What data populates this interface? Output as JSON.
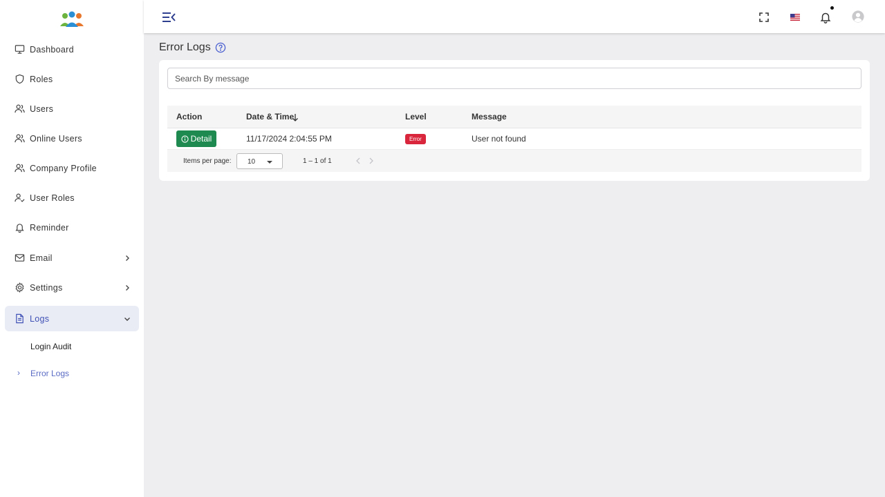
{
  "sidebar": {
    "items": [
      {
        "label": "Dashboard",
        "icon": "monitor-icon"
      },
      {
        "label": "Roles",
        "icon": "shield-icon"
      },
      {
        "label": "Users",
        "icon": "users-icon"
      },
      {
        "label": "Online Users",
        "icon": "users-icon"
      },
      {
        "label": "Company Profile",
        "icon": "users-icon"
      },
      {
        "label": "User Roles",
        "icon": "user-check-icon"
      },
      {
        "label": "Reminder",
        "icon": "bell-icon"
      },
      {
        "label": "Email",
        "icon": "mail-icon",
        "expandable": true
      },
      {
        "label": "Settings",
        "icon": "gear-icon",
        "expandable": true
      },
      {
        "label": "Logs",
        "icon": "file-icon",
        "expanded": true,
        "active": true
      }
    ],
    "sub_items": [
      {
        "label": "Login Audit"
      },
      {
        "label": "Error Logs",
        "active": true
      }
    ]
  },
  "page": {
    "title": "Error Logs"
  },
  "search": {
    "placeholder": "Search By message"
  },
  "table": {
    "columns": [
      "Action",
      "Date & Time",
      "Level",
      "Message"
    ],
    "sort_column": "Date & Time",
    "sort_direction": "desc",
    "rows": [
      {
        "action": "Detail",
        "datetime": "11/17/2024 2:04:55 PM",
        "level": "Error",
        "message": "User not found"
      }
    ]
  },
  "paginator": {
    "items_per_page_label": "Items per page:",
    "items_per_page": "10",
    "range": "1 – 1 of 1"
  },
  "colors": {
    "accent": "#3f51b5",
    "detail_button": "#1e8a4f",
    "error_badge": "#d9263c"
  }
}
